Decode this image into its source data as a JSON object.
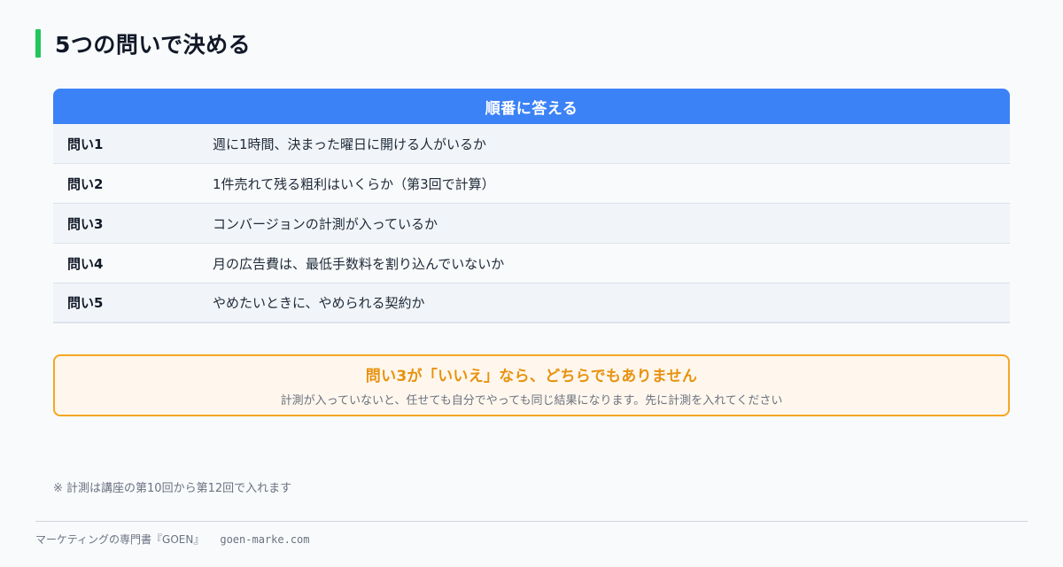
{
  "title": "5つの問いで決める",
  "table": {
    "header": "順番に答える",
    "rows": [
      {
        "label": "問い1",
        "text": "週に1時間、決まった曜日に開ける人がいるか"
      },
      {
        "label": "問い2",
        "text": "1件売れて残る粗利はいくらか（第3回で計算）"
      },
      {
        "label": "問い3",
        "text": "コンバージョンの計測が入っているか"
      },
      {
        "label": "問い4",
        "text": "月の広告費は、最低手数料を割り込んでいないか"
      },
      {
        "label": "問い5",
        "text": "やめたいときに、やめられる契約か"
      }
    ]
  },
  "warning": {
    "title": "問い3が「いいえ」なら、どちらでもありません",
    "text": "計測が入っていないと、任せても自分でやっても同じ結果になります。先に計測を入れてください"
  },
  "note": "※ 計測は講座の第10回から第12回で入れます",
  "footer": {
    "brand": "マーケティングの専門書『GOEN』",
    "url": "goen-marke.com"
  },
  "colors": {
    "accent_bar": "#22c55e",
    "header_blue": "#3b82f6",
    "warning_orange": "#f5a623"
  }
}
